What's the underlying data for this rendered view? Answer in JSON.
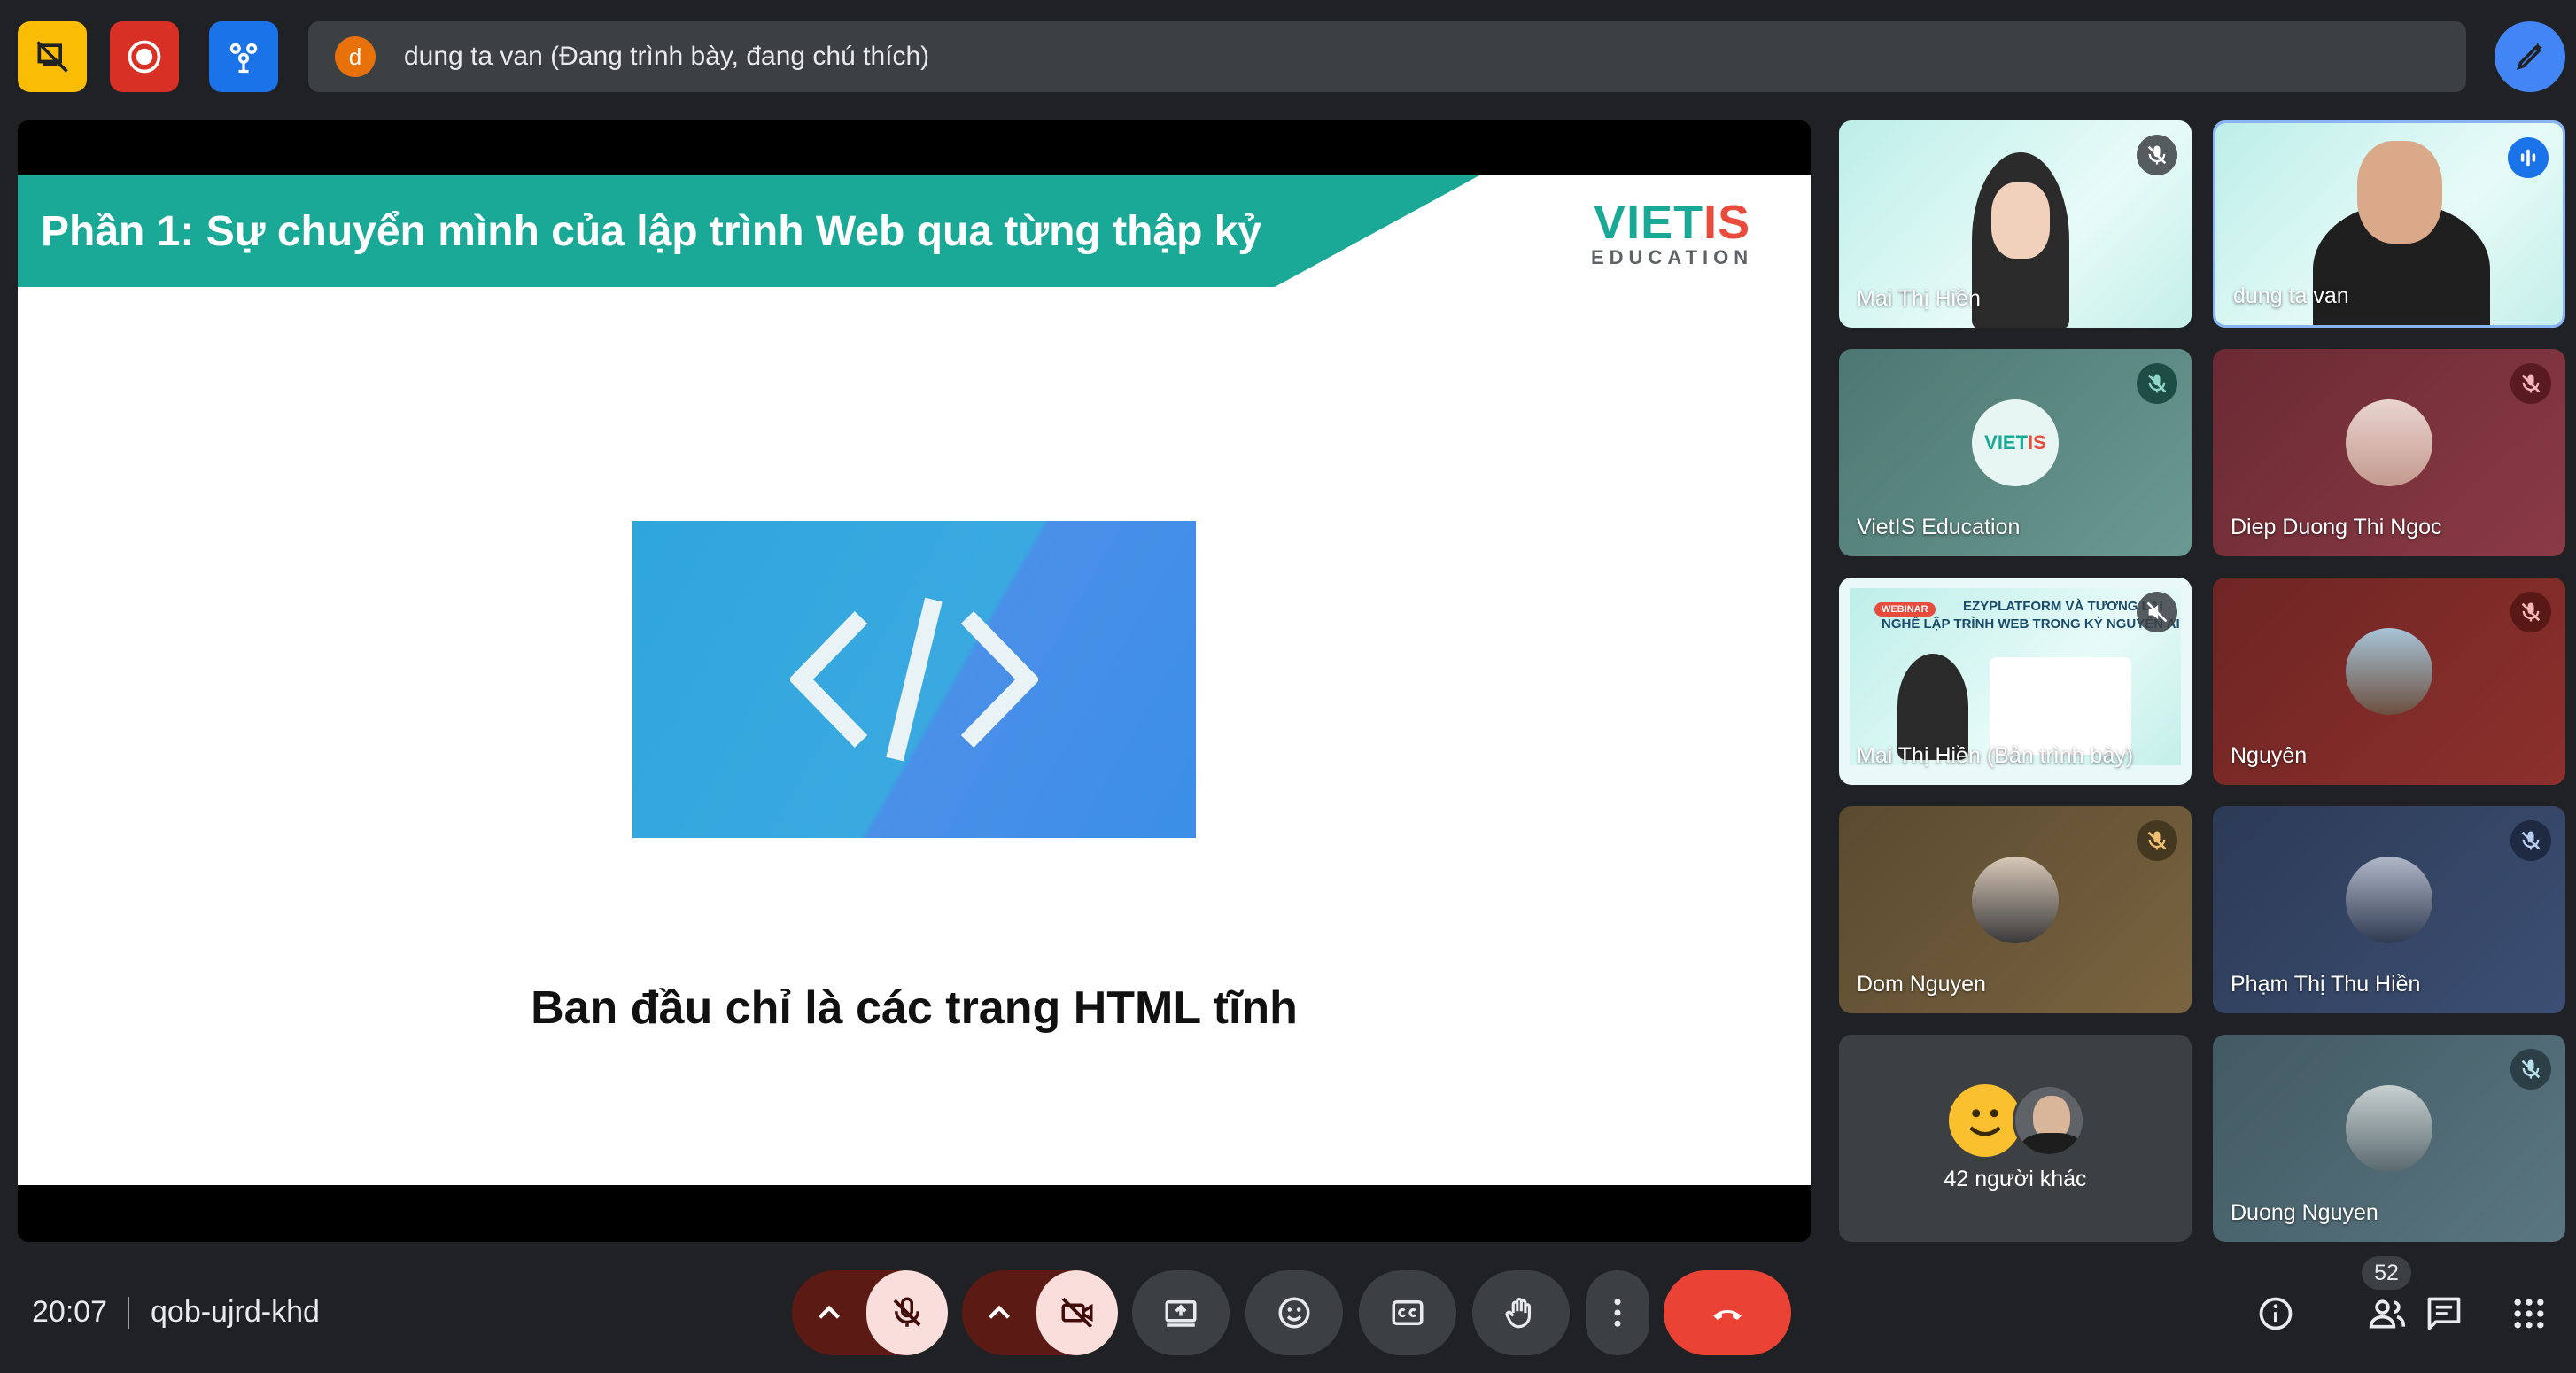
{
  "top_bar": {
    "presenting_avatar_letter": "d",
    "presenting_text": "dung ta van (Đang trình bày, đang chú thích)",
    "colors": {
      "host_controls": "#fbbc04",
      "record": "#d93025",
      "activities": "#1a73e8",
      "annotate": "#4285f4"
    }
  },
  "slide": {
    "title": "Phần 1: Sự chuyển mình của lập trình Web qua từng thập kỷ",
    "logo_part1": "VIET",
    "logo_part2": "IS",
    "logo_sub": "EDUCATION",
    "caption": "Ban đầu chỉ là các trang HTML tĩnh",
    "accent_color": "#1aa997"
  },
  "participants": [
    {
      "name": "Mai Thị Hiền",
      "mic": "muted"
    },
    {
      "name": "dung ta van",
      "mic": "speaking"
    },
    {
      "name": "VietIS Education",
      "mic": "muted"
    },
    {
      "name": "Diep Duong Thi Ngoc",
      "mic": "muted"
    },
    {
      "name": "Mai Thị Hiền (Bản trình bày)",
      "mic": "muted"
    },
    {
      "name": "Nguyên",
      "mic": "muted"
    },
    {
      "name": "Dom Nguyen",
      "mic": "muted"
    },
    {
      "name": "Phạm Thị Thu Hiền",
      "mic": "muted"
    },
    {
      "name": "Duong Nguyen",
      "mic": "muted"
    }
  ],
  "mini_slide": {
    "tag": "WEBINAR",
    "line1": "EZYPLATFORM VÀ TƯƠNG LAI",
    "line2": "NGHỀ LẬP TRÌNH WEB TRONG KỶ NGUYÊN AI"
  },
  "others_label": "42 người khác",
  "bottom_bar": {
    "time": "20:07",
    "meeting_code": "qob-ujrd-khd",
    "participant_count": "52"
  }
}
